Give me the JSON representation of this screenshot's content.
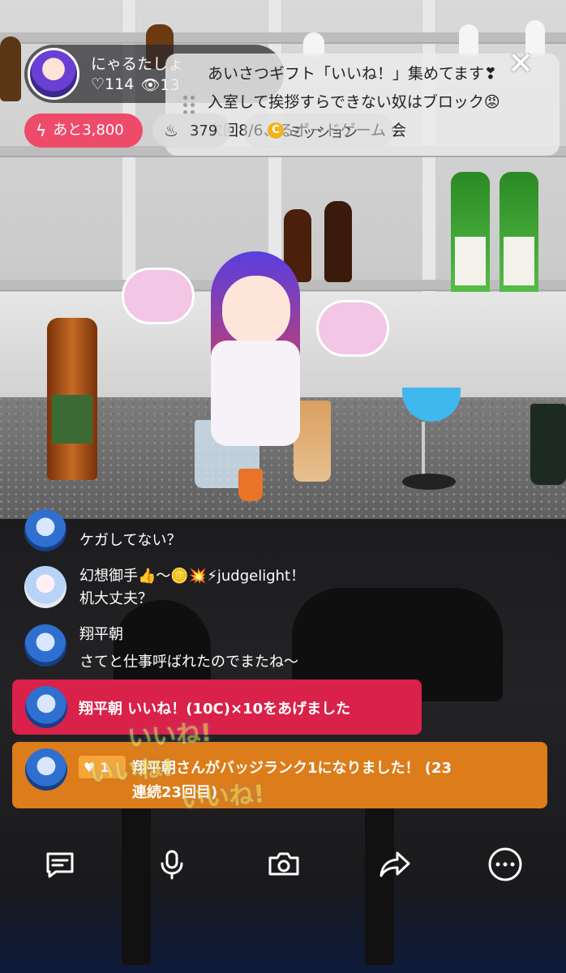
{
  "host": {
    "name": "にゃるたしょ",
    "likes": "♡114",
    "viewers": "👁13"
  },
  "pinned_message": {
    "lines": [
      "あいさつギフト「いいね！」集めてます❣",
      "入室して挨拶すらできない奴はブロック😡",
      "次回8/6、るボードゲーム 会"
    ]
  },
  "close_icon": "close-icon",
  "goal": {
    "label": "あと3,800",
    "icon": "bolt-icon"
  },
  "fire": {
    "count": "379",
    "icon": "flame-icon"
  },
  "mission": {
    "label": "ミッション",
    "coin_glyph": "C"
  },
  "chat": [
    {
      "name": "翔平朝",
      "text": "ケガしてない？"
    },
    {
      "name": "幻想御手👍〜🪙💥⚡judgelight！",
      "text": "机大丈夫？"
    },
    {
      "name": "翔平朝",
      "text": "さてと仕事呼ばれたのでまたね〜"
    }
  ],
  "gift_event": {
    "text": "翔平朝 いいね！(10C)×10をあげました"
  },
  "badge_event": {
    "rank": "1",
    "line1": "翔平朝さんがバッジランク1になりました！ (23",
    "line2": "連続23回目)"
  },
  "sticker_text": [
    "いいね!",
    "いいね!",
    "いいね!"
  ],
  "toolbar": {
    "items": [
      "comment-icon",
      "microphone-icon",
      "camera-icon",
      "share-icon",
      "more-icon"
    ]
  },
  "colors": {
    "goal_pill": "#ee4a6a",
    "gift_bar": "#d9214a",
    "badge_bar": "#dd7c1a",
    "coin": "#f2b21d"
  }
}
